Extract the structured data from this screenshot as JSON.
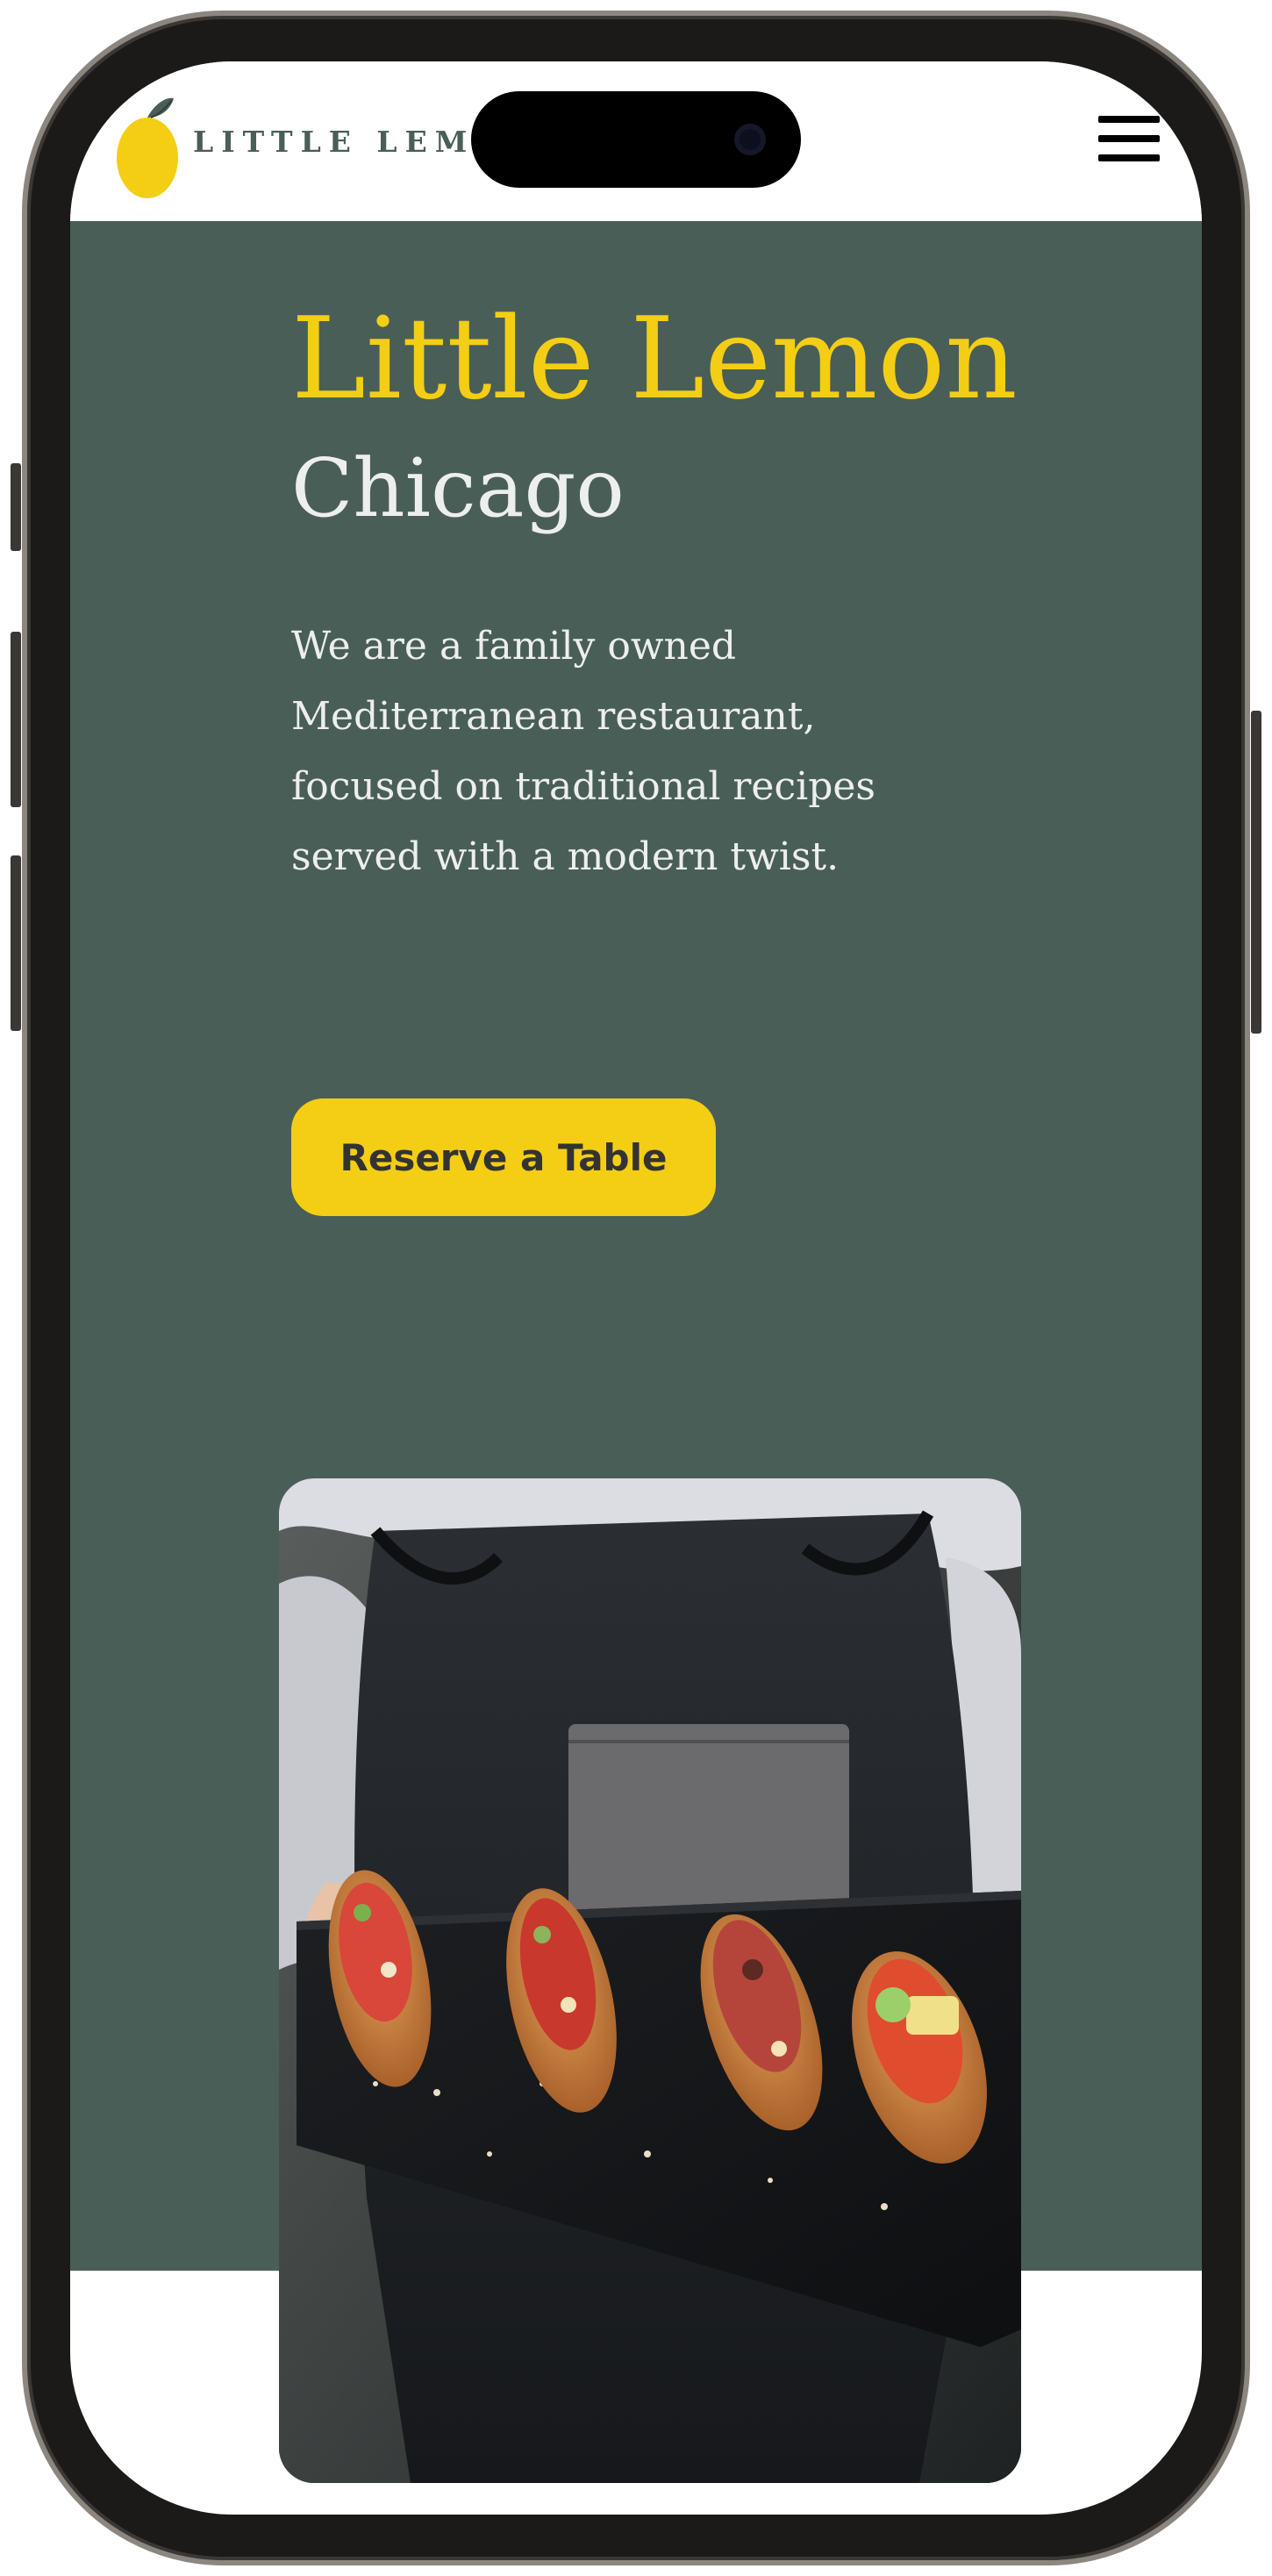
{
  "header": {
    "logo_text": "LITTLE LEMO",
    "logo_icon": "lemon-icon",
    "menu_icon": "hamburger-menu-icon"
  },
  "hero": {
    "title": "Little Lemon",
    "subtitle": "Chicago",
    "description": "We are a family owned Mediterranean restaurant, focused on traditional recipes served with a modern twist.",
    "cta_label": "Reserve a Table",
    "image_subject": "chef-holding-bruschetta-platter"
  },
  "colors": {
    "primary_green": "#495e57",
    "primary_yellow": "#f4ce14",
    "highlight_light": "#edefee",
    "dark_text": "#333333"
  }
}
